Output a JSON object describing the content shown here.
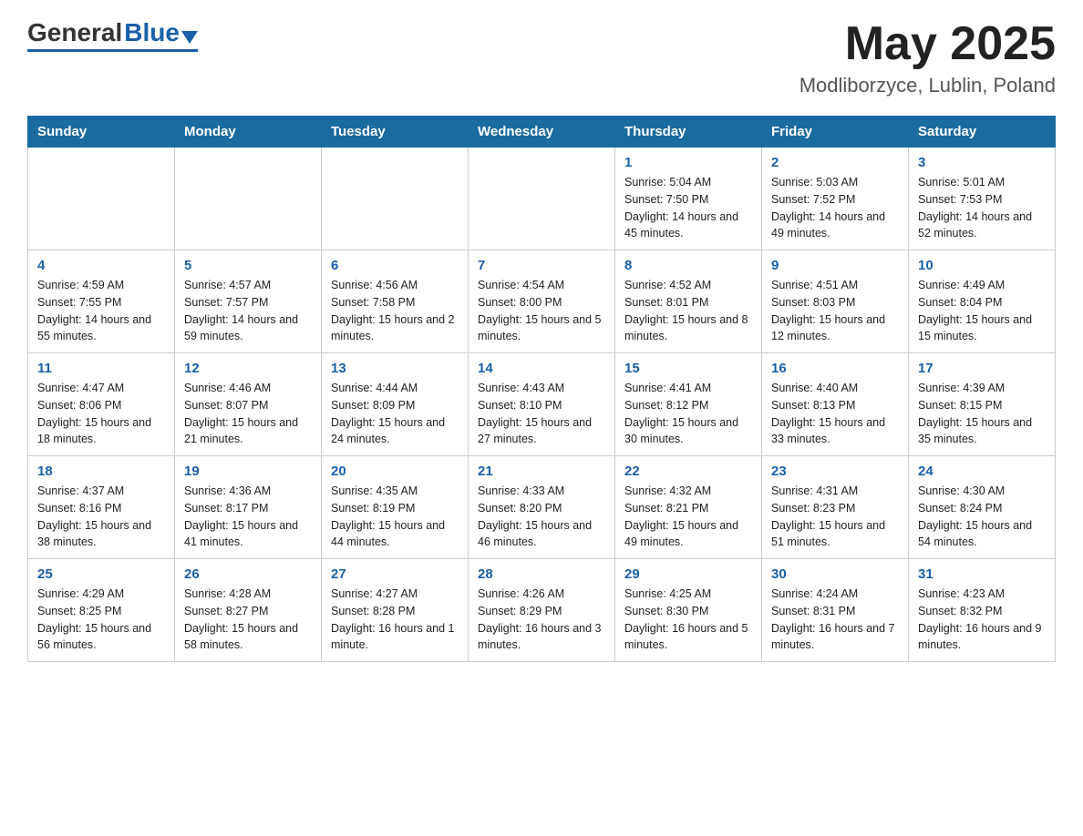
{
  "header": {
    "logo_general": "General",
    "logo_blue": "Blue",
    "month_title": "May 2025",
    "location": "Modliborzyce, Lublin, Poland"
  },
  "weekdays": [
    "Sunday",
    "Monday",
    "Tuesday",
    "Wednesday",
    "Thursday",
    "Friday",
    "Saturday"
  ],
  "weeks": [
    [
      {
        "day": "",
        "info": ""
      },
      {
        "day": "",
        "info": ""
      },
      {
        "day": "",
        "info": ""
      },
      {
        "day": "",
        "info": ""
      },
      {
        "day": "1",
        "info": "Sunrise: 5:04 AM\nSunset: 7:50 PM\nDaylight: 14 hours and 45 minutes."
      },
      {
        "day": "2",
        "info": "Sunrise: 5:03 AM\nSunset: 7:52 PM\nDaylight: 14 hours and 49 minutes."
      },
      {
        "day": "3",
        "info": "Sunrise: 5:01 AM\nSunset: 7:53 PM\nDaylight: 14 hours and 52 minutes."
      }
    ],
    [
      {
        "day": "4",
        "info": "Sunrise: 4:59 AM\nSunset: 7:55 PM\nDaylight: 14 hours and 55 minutes."
      },
      {
        "day": "5",
        "info": "Sunrise: 4:57 AM\nSunset: 7:57 PM\nDaylight: 14 hours and 59 minutes."
      },
      {
        "day": "6",
        "info": "Sunrise: 4:56 AM\nSunset: 7:58 PM\nDaylight: 15 hours and 2 minutes."
      },
      {
        "day": "7",
        "info": "Sunrise: 4:54 AM\nSunset: 8:00 PM\nDaylight: 15 hours and 5 minutes."
      },
      {
        "day": "8",
        "info": "Sunrise: 4:52 AM\nSunset: 8:01 PM\nDaylight: 15 hours and 8 minutes."
      },
      {
        "day": "9",
        "info": "Sunrise: 4:51 AM\nSunset: 8:03 PM\nDaylight: 15 hours and 12 minutes."
      },
      {
        "day": "10",
        "info": "Sunrise: 4:49 AM\nSunset: 8:04 PM\nDaylight: 15 hours and 15 minutes."
      }
    ],
    [
      {
        "day": "11",
        "info": "Sunrise: 4:47 AM\nSunset: 8:06 PM\nDaylight: 15 hours and 18 minutes."
      },
      {
        "day": "12",
        "info": "Sunrise: 4:46 AM\nSunset: 8:07 PM\nDaylight: 15 hours and 21 minutes."
      },
      {
        "day": "13",
        "info": "Sunrise: 4:44 AM\nSunset: 8:09 PM\nDaylight: 15 hours and 24 minutes."
      },
      {
        "day": "14",
        "info": "Sunrise: 4:43 AM\nSunset: 8:10 PM\nDaylight: 15 hours and 27 minutes."
      },
      {
        "day": "15",
        "info": "Sunrise: 4:41 AM\nSunset: 8:12 PM\nDaylight: 15 hours and 30 minutes."
      },
      {
        "day": "16",
        "info": "Sunrise: 4:40 AM\nSunset: 8:13 PM\nDaylight: 15 hours and 33 minutes."
      },
      {
        "day": "17",
        "info": "Sunrise: 4:39 AM\nSunset: 8:15 PM\nDaylight: 15 hours and 35 minutes."
      }
    ],
    [
      {
        "day": "18",
        "info": "Sunrise: 4:37 AM\nSunset: 8:16 PM\nDaylight: 15 hours and 38 minutes."
      },
      {
        "day": "19",
        "info": "Sunrise: 4:36 AM\nSunset: 8:17 PM\nDaylight: 15 hours and 41 minutes."
      },
      {
        "day": "20",
        "info": "Sunrise: 4:35 AM\nSunset: 8:19 PM\nDaylight: 15 hours and 44 minutes."
      },
      {
        "day": "21",
        "info": "Sunrise: 4:33 AM\nSunset: 8:20 PM\nDaylight: 15 hours and 46 minutes."
      },
      {
        "day": "22",
        "info": "Sunrise: 4:32 AM\nSunset: 8:21 PM\nDaylight: 15 hours and 49 minutes."
      },
      {
        "day": "23",
        "info": "Sunrise: 4:31 AM\nSunset: 8:23 PM\nDaylight: 15 hours and 51 minutes."
      },
      {
        "day": "24",
        "info": "Sunrise: 4:30 AM\nSunset: 8:24 PM\nDaylight: 15 hours and 54 minutes."
      }
    ],
    [
      {
        "day": "25",
        "info": "Sunrise: 4:29 AM\nSunset: 8:25 PM\nDaylight: 15 hours and 56 minutes."
      },
      {
        "day": "26",
        "info": "Sunrise: 4:28 AM\nSunset: 8:27 PM\nDaylight: 15 hours and 58 minutes."
      },
      {
        "day": "27",
        "info": "Sunrise: 4:27 AM\nSunset: 8:28 PM\nDaylight: 16 hours and 1 minute."
      },
      {
        "day": "28",
        "info": "Sunrise: 4:26 AM\nSunset: 8:29 PM\nDaylight: 16 hours and 3 minutes."
      },
      {
        "day": "29",
        "info": "Sunrise: 4:25 AM\nSunset: 8:30 PM\nDaylight: 16 hours and 5 minutes."
      },
      {
        "day": "30",
        "info": "Sunrise: 4:24 AM\nSunset: 8:31 PM\nDaylight: 16 hours and 7 minutes."
      },
      {
        "day": "31",
        "info": "Sunrise: 4:23 AM\nSunset: 8:32 PM\nDaylight: 16 hours and 9 minutes."
      }
    ]
  ]
}
